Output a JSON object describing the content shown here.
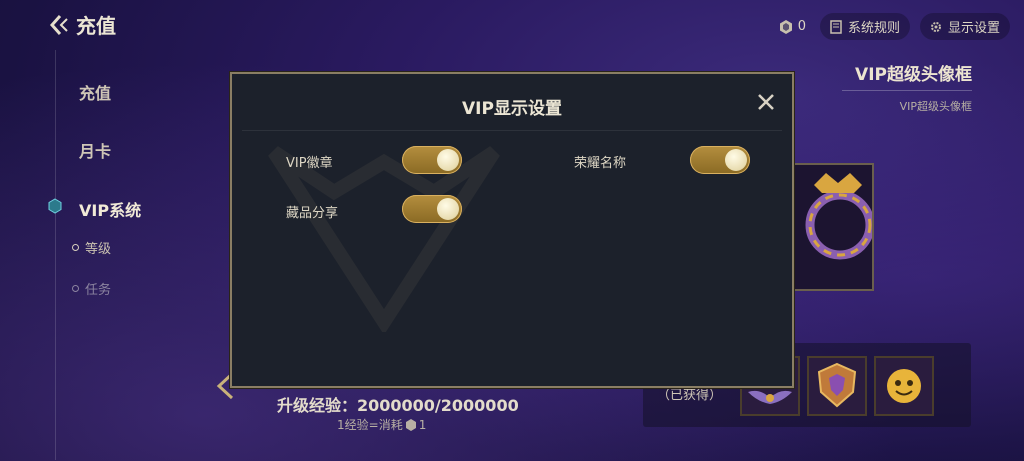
{
  "header": {
    "title": "充值"
  },
  "topbar": {
    "coin_count": "0",
    "rules_label": "系统规则",
    "display_settings_label": "显示设置"
  },
  "sidebar": {
    "items": [
      {
        "label": "充值"
      },
      {
        "label": "月卡"
      },
      {
        "label": "VIP系统"
      }
    ],
    "sub_items": [
      {
        "label": "等级"
      },
      {
        "label": "任务"
      }
    ]
  },
  "frame": {
    "title": "VIP超级头像框",
    "subtitle": "VIP超级头像框"
  },
  "progress": {
    "label": "升级经验：2000000/2000000",
    "note_prefix": "1经验=消耗",
    "note_suffix": "1"
  },
  "rewards": {
    "owned_label": "（已获得）"
  },
  "modal": {
    "title": "VIP显示设置",
    "options": [
      {
        "label": "VIP徽章",
        "enabled": true
      },
      {
        "label": "荣耀名称",
        "enabled": true
      },
      {
        "label": "藏品分享",
        "enabled": true
      }
    ]
  },
  "colors": {
    "accent": "#b48e3e",
    "panel": "#1c212b",
    "border": "#8a7e64"
  }
}
